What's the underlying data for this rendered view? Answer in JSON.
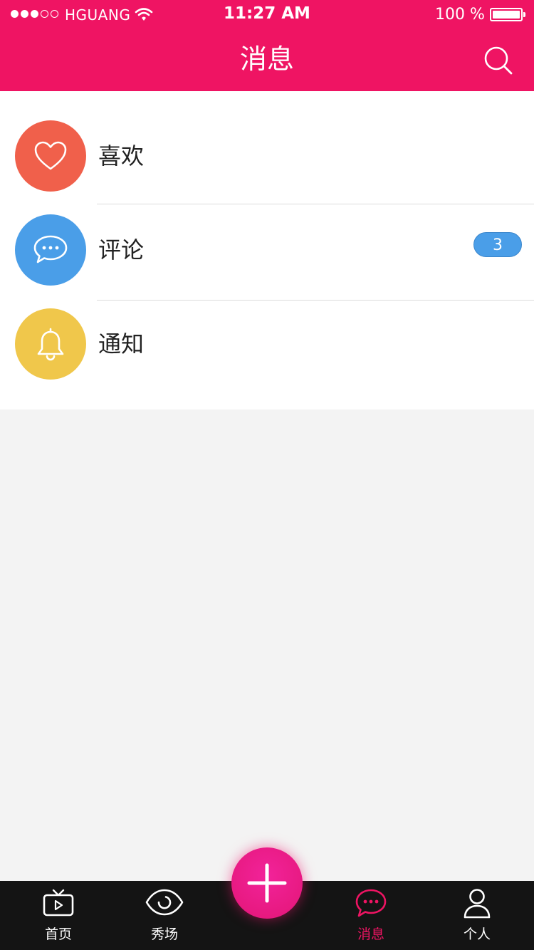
{
  "status_bar": {
    "carrier": "HGUANG",
    "time": "11:27 AM",
    "battery": "100 %"
  },
  "header": {
    "title": "消息"
  },
  "items": [
    {
      "label": "喜欢",
      "icon": "heart-icon",
      "color": "#f0604b"
    },
    {
      "label": "评论",
      "icon": "chat-bubble-icon",
      "color": "#4a9ee8",
      "badge": "3"
    },
    {
      "label": "通知",
      "icon": "bell-icon",
      "color": "#f0c74b"
    }
  ],
  "tabs": [
    {
      "label": "首页",
      "icon": "tv-icon"
    },
    {
      "label": "秀场",
      "icon": "eye-icon"
    },
    {
      "label": "消息",
      "icon": "message-icon",
      "active": true
    },
    {
      "label": "个人",
      "icon": "person-icon"
    }
  ],
  "fab": {
    "icon": "plus-icon"
  },
  "colors": {
    "accent": "#ef1463",
    "tabbar": "#141414"
  }
}
